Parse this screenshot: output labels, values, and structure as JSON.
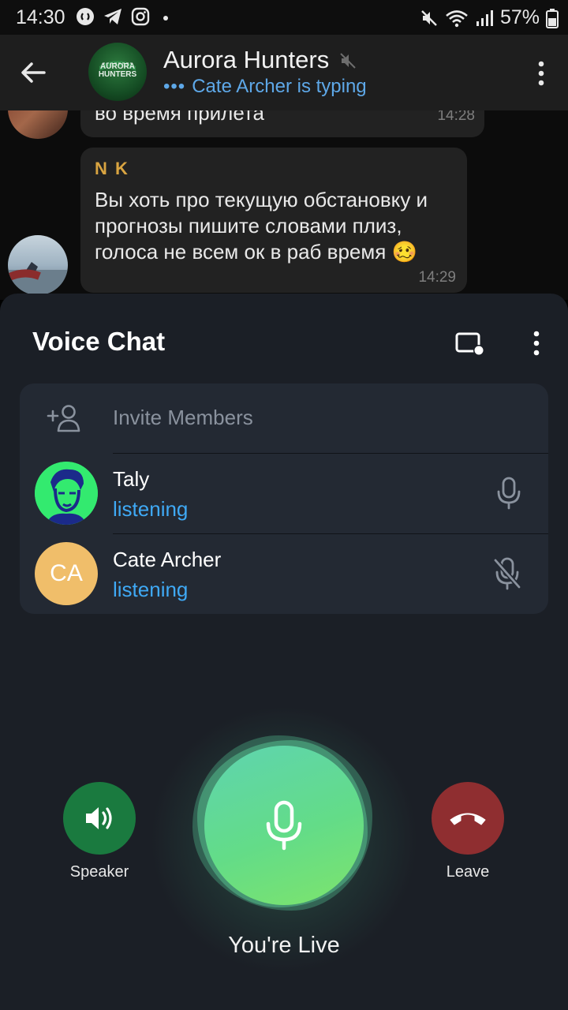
{
  "status_bar": {
    "time": "14:30",
    "battery": "57%",
    "icons_left": [
      "shazam-icon",
      "telegram-icon",
      "instagram-icon",
      "dot-icon"
    ],
    "icons_right": [
      "mute-icon",
      "wifi-icon",
      "signal-icon",
      "battery-icon"
    ]
  },
  "header": {
    "title": "Aurora Hunters",
    "avatar_text": "AURORA HUNTERS",
    "typing": "Cate Archer is typing",
    "typing_dots": "•••"
  },
  "messages": [
    {
      "text": "во время прилета",
      "time": "14:28"
    },
    {
      "sender": "N K",
      "text": "Вы хоть про текущую обстановку и прогнозы пишите словами плиз, голоса не всем ок в раб время 🥴",
      "time": "14:29"
    }
  ],
  "voice_chat": {
    "title": "Voice Chat",
    "invite_label": "Invite Members",
    "members": [
      {
        "name": "Taly",
        "status": "listening",
        "mic": "mic-icon"
      },
      {
        "name": "Cate Archer",
        "initials": "CA",
        "status": "listening",
        "mic": "mic-off-icon"
      }
    ],
    "speaker_label": "Speaker",
    "leave_label": "Leave",
    "live_label": "You're Live"
  },
  "colors": {
    "accent_blue": "#3fa9f5",
    "live_green": "#63dc88",
    "leave_red": "#8f2e30",
    "speaker_green": "#1a7a3f",
    "sender_orange": "#d9a441"
  }
}
